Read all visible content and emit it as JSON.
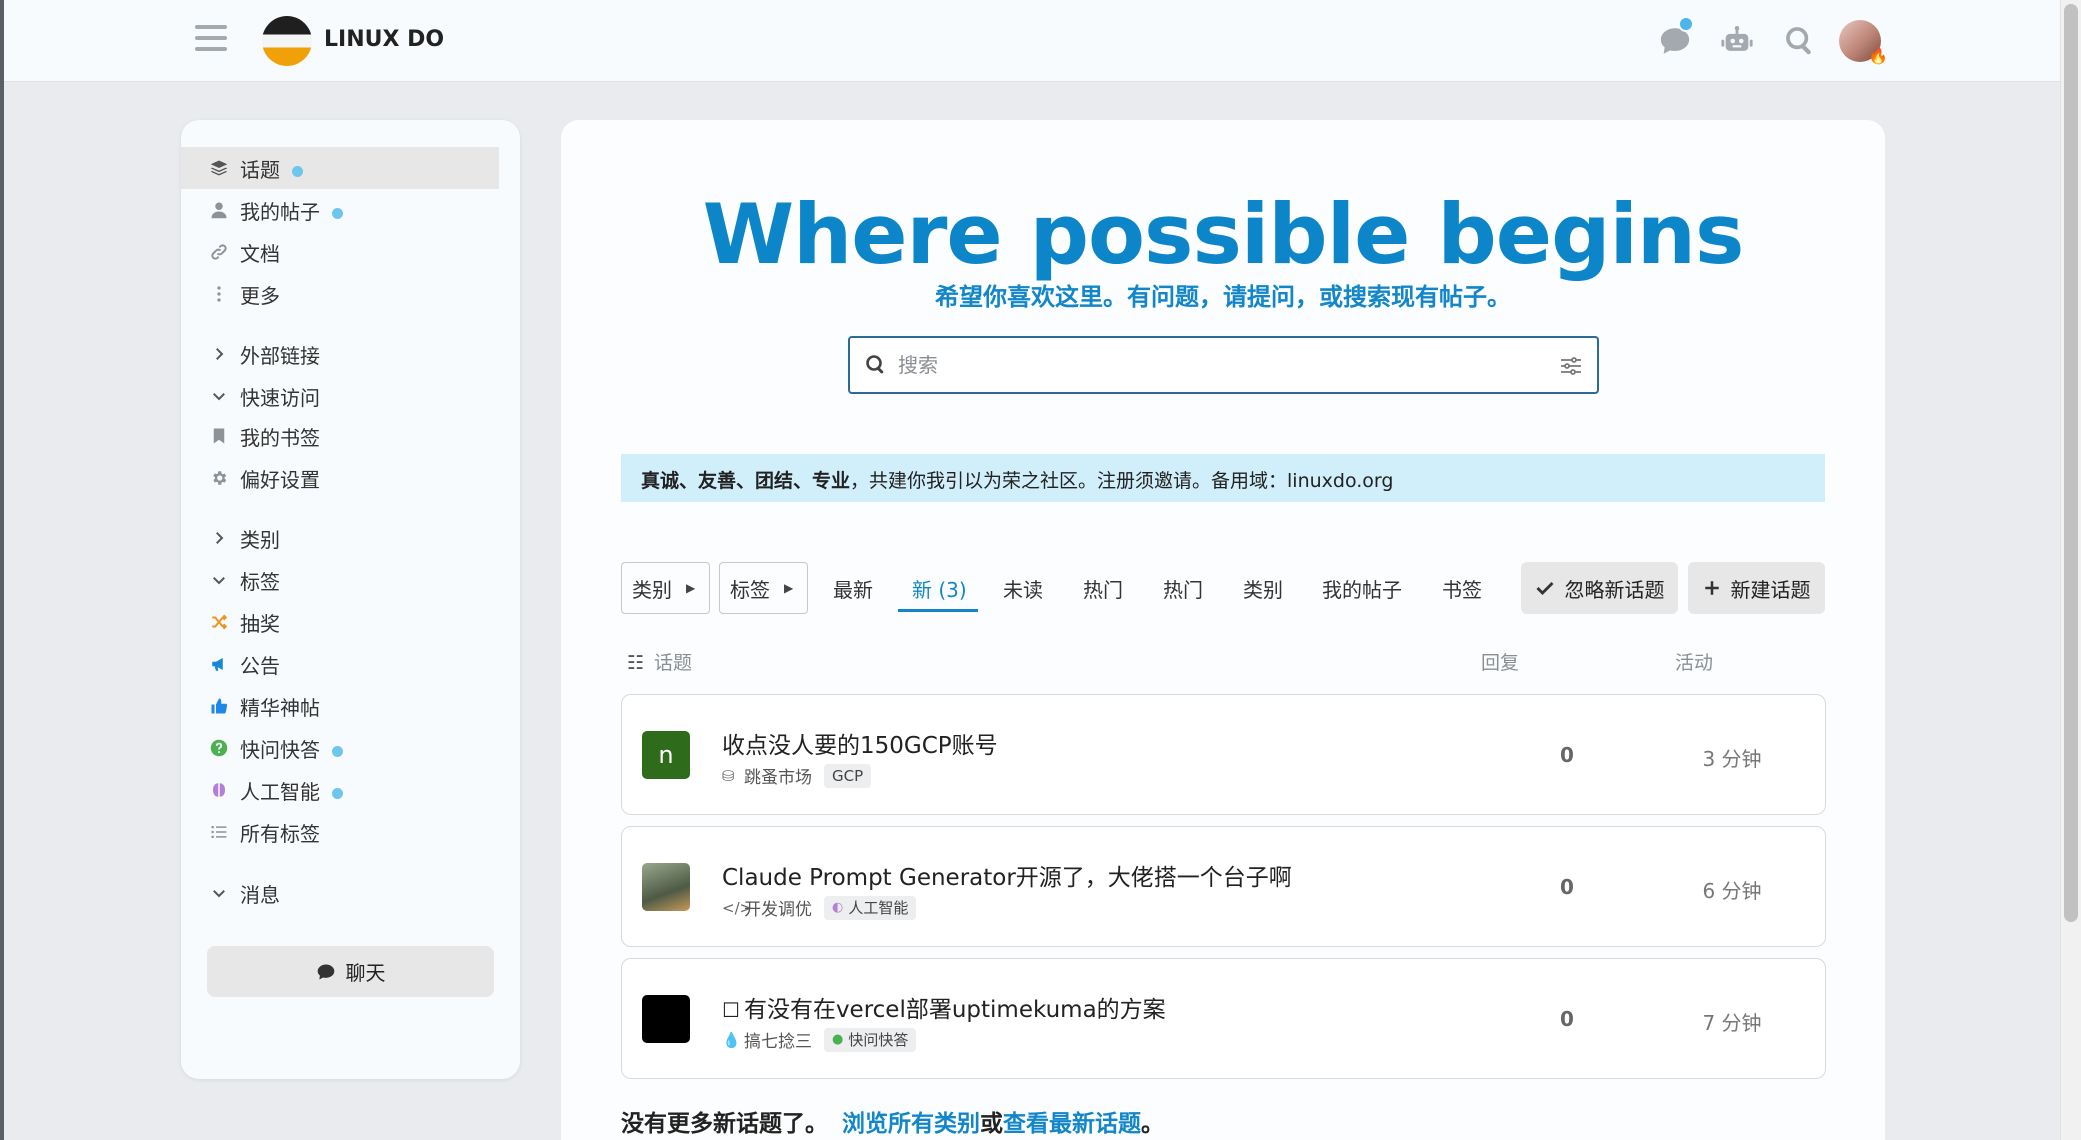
{
  "header": {
    "site_name": "LINUX DO"
  },
  "sidebar": {
    "items": [
      {
        "label": "话题",
        "dot": true,
        "active": true
      },
      {
        "label": "我的帖子",
        "dot": true
      },
      {
        "label": "文档"
      },
      {
        "label": "更多"
      },
      {
        "label": "外部链接"
      },
      {
        "label": "快速访问"
      },
      {
        "label": "我的书签"
      },
      {
        "label": "偏好设置"
      },
      {
        "label": "类别"
      },
      {
        "label": "标签"
      },
      {
        "label": "抽奖"
      },
      {
        "label": "公告"
      },
      {
        "label": "精华神帖"
      },
      {
        "label": "快问快答",
        "dot": true
      },
      {
        "label": "人工智能",
        "dot": true
      },
      {
        "label": "所有标签"
      },
      {
        "label": "消息"
      }
    ],
    "chat_label": "聊天"
  },
  "hero": {
    "title": "Where possible begins",
    "subtitle": "希望你喜欢这里。有问题，请提问，或搜索现有帖子。"
  },
  "search": {
    "placeholder": "搜索",
    "value": ""
  },
  "notice": {
    "bold": "真诚、友善、团结、专业",
    "text": "，共建你我引以为荣之社区。注册须邀请。备用域：linuxdo.org"
  },
  "nav": {
    "category_dropdown": "类别",
    "tag_dropdown": "标签",
    "tabs": [
      "最新",
      "新 (3)",
      "未读",
      "热门",
      "热门",
      "类别",
      "我的帖子",
      "书签"
    ],
    "active_tab": "新 (3)",
    "dismiss_label": "忽略新话题",
    "new_topic_label": "新建话题"
  },
  "columns": {
    "topic": "话题",
    "replies": "回复",
    "activity": "活动"
  },
  "topics": [
    {
      "title": "收点没人要的150GCP账号",
      "category": "跳蚤市场",
      "tag": "GCP",
      "replies": "0",
      "activity": "3 分钟",
      "avatar_letter": "n",
      "avatar_color": "#2e6b1a"
    },
    {
      "title": "Claude Prompt Generator开源了，大佬搭一个台子啊",
      "category": "开发调优",
      "tag": "人工智能",
      "replies": "0",
      "activity": "6 分钟",
      "avatar_color": "#6b7a62"
    },
    {
      "title": "有没有在vercel部署uptimekuma的方案",
      "category": "搞七捻三",
      "tag": "快问快答",
      "replies": "0",
      "activity": "7 分钟",
      "avatar_color": "#000000"
    }
  ],
  "footer": {
    "text": "没有更多新话题了。",
    "link1": "浏览所有类别",
    "or": "或",
    "link2": "查看最新话题",
    "end": "。"
  },
  "colors": {
    "accent": "#1286c8",
    "notice_bg": "#d1eefb",
    "dot": "#6ec6ef"
  }
}
